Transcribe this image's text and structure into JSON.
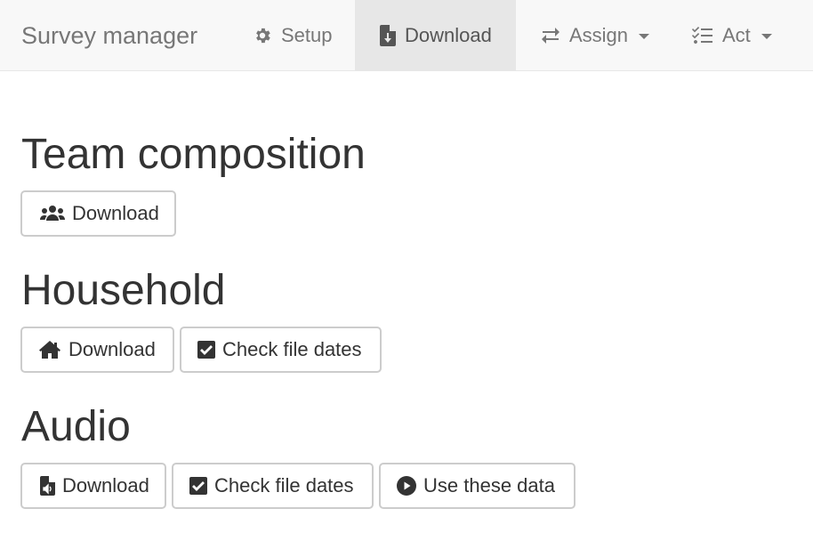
{
  "navbar": {
    "brand": "Survey manager",
    "items": [
      {
        "label": "Setup",
        "icon": "gear-icon",
        "active": false,
        "dropdown": false
      },
      {
        "label": "Download",
        "icon": "file-download-icon",
        "active": true,
        "dropdown": false
      },
      {
        "label": "Assign",
        "icon": "exchange-arrows-icon",
        "active": false,
        "dropdown": true
      },
      {
        "label": "Act",
        "icon": "checklist-icon",
        "active": false,
        "dropdown": true
      }
    ]
  },
  "sections": [
    {
      "title": "Team composition",
      "buttons": [
        {
          "label": "Download",
          "icon": "users-icon"
        }
      ]
    },
    {
      "title": "Household",
      "buttons": [
        {
          "label": "Download",
          "icon": "home-icon"
        },
        {
          "label": "Check file dates",
          "icon": "check-square-icon"
        }
      ]
    },
    {
      "title": "Audio",
      "buttons": [
        {
          "label": "Download",
          "icon": "audio-file-icon"
        },
        {
          "label": "Check file dates",
          "icon": "check-square-icon"
        },
        {
          "label": "Use these data",
          "icon": "play-circle-icon"
        }
      ]
    }
  ]
}
